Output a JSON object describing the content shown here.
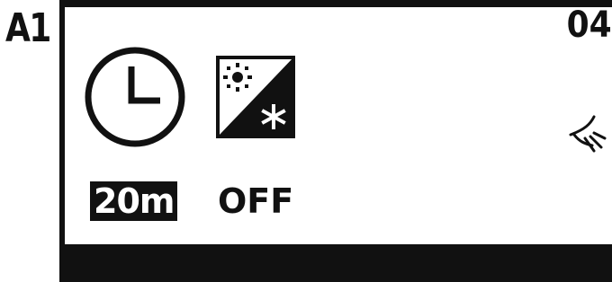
{
  "screen": {
    "id_label": "A1",
    "page_number": "04"
  },
  "timer": {
    "icon": "clock-icon",
    "value": "20m"
  },
  "mode": {
    "icon": "sun-snowflake-mode-icon",
    "status": "OFF"
  },
  "fan": {
    "icon": "fan-icon"
  },
  "colors": {
    "foreground": "#111111",
    "background": "#ffffff"
  }
}
